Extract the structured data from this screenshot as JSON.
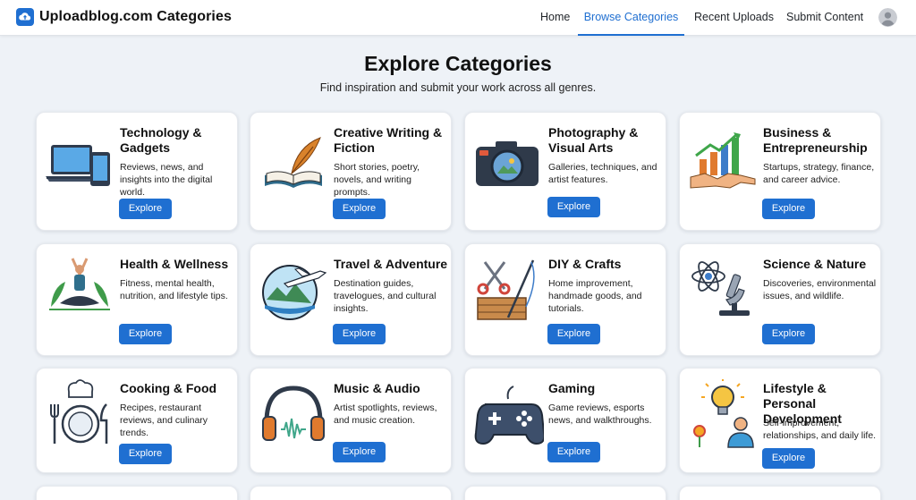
{
  "header": {
    "brand_title": "Uploadblog.com Categories",
    "nav": [
      "Home",
      "Browse Categories",
      "Recent Uploads",
      "Submit Content"
    ],
    "active_nav": "Browse Categories"
  },
  "page": {
    "title": "Explore Categories",
    "subtitle": "Find inspiration and submit your work across all genres."
  },
  "colors": {
    "accent": "#1f6fd1",
    "background": "#eef2f7",
    "card": "#ffffff"
  },
  "cards": [
    {
      "title": "Technology & Gadgets",
      "description": "Reviews, news, and insights into the digital world.",
      "button": "Explore",
      "icon": "laptop-phone-icon"
    },
    {
      "title": "Creative Writing & Fiction",
      "description": "Short stories, poetry, novels, and writing prompts.",
      "button": "Explore",
      "icon": "quill-book-icon"
    },
    {
      "title": "Photography & Visual Arts",
      "description": "Galleries, techniques, and artist features.",
      "button": "Explore",
      "icon": "camera-icon"
    },
    {
      "title": "Business & Entrepreneurship",
      "description": "Startups, strategy, finance, and career advice.",
      "button": "Explore",
      "icon": "growth-handshake-icon"
    },
    {
      "title": "Health & Wellness",
      "description": "Fitness, mental health, nutrition, and lifestyle tips.",
      "button": "Explore",
      "icon": "yoga-icon"
    },
    {
      "title": "Travel & Adventure",
      "description": "Destination guides, travelogues, and cultural insights.",
      "button": "Explore",
      "icon": "airplane-landscape-icon"
    },
    {
      "title": "DIY & Crafts",
      "description": "Home improvement, handmade goods, and tutorials.",
      "button": "Explore",
      "icon": "scissors-wood-icon"
    },
    {
      "title": "Science & Nature",
      "description": "Discoveries, environmental issues, and wildlife.",
      "button": "Explore",
      "icon": "atom-microscope-icon"
    },
    {
      "title": "Cooking & Food",
      "description": "Recipes, restaurant reviews, and culinary trends.",
      "button": "Explore",
      "icon": "chef-plate-icon"
    },
    {
      "title": "Music & Audio",
      "description": "Artist spotlights, reviews, and music creation.",
      "button": "Explore",
      "icon": "headphones-icon"
    },
    {
      "title": "Gaming",
      "description": "Game reviews, esports news, and walkthroughs.",
      "button": "Explore",
      "icon": "gamepad-icon"
    },
    {
      "title": "Lifestyle & Personal Development",
      "description": "Self-improvement, relationships, and daily life.",
      "button": "Explore",
      "icon": "lightbulb-person-icon"
    }
  ]
}
